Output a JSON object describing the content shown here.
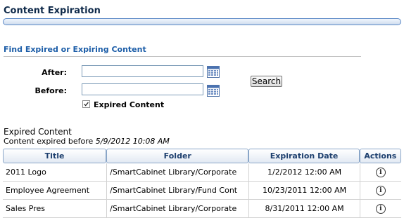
{
  "page": {
    "title": "Content Expiration"
  },
  "search": {
    "heading": "Find Expired or Expiring Content",
    "after_label": "After:",
    "after_value": "",
    "before_label": "Before:",
    "before_value": "",
    "checkbox_label": "Expired Content",
    "checkbox_checked": true,
    "button_label": "Search"
  },
  "results": {
    "heading": "Expired Content",
    "sub_prefix": "Content expired before",
    "sub_date": "5/9/2012 10:08 AM",
    "columns": [
      "Title",
      "Folder",
      "Expiration Date",
      "Actions"
    ],
    "rows": [
      {
        "title": "2011 Logo",
        "folder": "/SmartCabinet Library/Corporate",
        "expiration": "1/2/2012 12:00 AM",
        "action_icon": "info-icon"
      },
      {
        "title": "Employee Agreement",
        "folder": "/SmartCabinet Library/Fund Cont",
        "expiration": "10/23/2011 12:00 AM",
        "action_icon": "info-icon"
      },
      {
        "title": "Sales Pres",
        "folder": "/SmartCabinet Library/Corporate",
        "expiration": "8/31/2011 12:00 AM",
        "action_icon": "info-icon"
      }
    ]
  },
  "colors": {
    "title_text": "#0f2a4a",
    "section_heading": "#1d5ea8",
    "title_bar_border": "#5a88c6",
    "grid_header_text": "#1d3f6e"
  }
}
